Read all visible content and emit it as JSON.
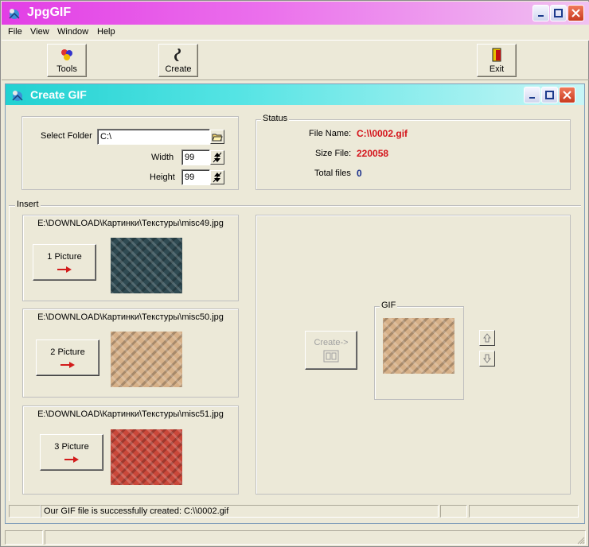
{
  "app": {
    "title": "JpgGIF",
    "menu": [
      "File",
      "View",
      "Window",
      "Help"
    ],
    "toolbar": {
      "tools": "Tools",
      "create": "Create",
      "exit": "Exit"
    }
  },
  "child": {
    "title": "Create GIF",
    "settings": {
      "select_folder_label": "Select Folder",
      "folder_value": "C:\\",
      "width_label": "Width",
      "width_value": "99",
      "height_label": "Height",
      "height_value": "99"
    },
    "status": {
      "group_label": "Status",
      "file_name_label": "File Name:",
      "file_name_value": "C:\\\\0002.gif",
      "size_file_label": "Size File:",
      "size_file_value": "220058",
      "total_files_label": "Total files",
      "total_files_value": "0"
    },
    "insert": {
      "group_label": "Insert",
      "pictures": [
        {
          "path": "E:\\DOWNLOAD\\Картинки\\Текстуры\\misc49.jpg",
          "button": "1 Picture",
          "color": "#2f4a52"
        },
        {
          "path": "E:\\DOWNLOAD\\Картинки\\Текстуры\\misc50.jpg",
          "button": "2 Picture",
          "color": "#d6b088"
        },
        {
          "path": "E:\\DOWNLOAD\\Картинки\\Текстуры\\misc51.jpg",
          "button": "3 Picture",
          "color": "#c9483a"
        }
      ]
    },
    "output": {
      "create_button": "Create->",
      "gif_label": "GIF"
    },
    "statusbar": "Our GIF file is successfully created: C:\\\\0002.gif"
  }
}
